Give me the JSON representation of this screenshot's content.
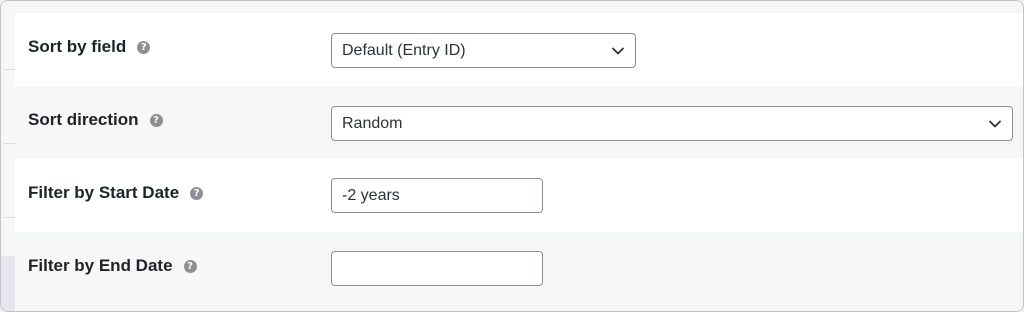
{
  "settings": {
    "sort_field": {
      "label": "Sort by field",
      "value": "Default (Entry ID)"
    },
    "sort_direction": {
      "label": "Sort direction",
      "value": "Random"
    },
    "start_date": {
      "label": "Filter by Start Date",
      "value": "-2 years"
    },
    "end_date": {
      "label": "Filter by End Date",
      "value": ""
    }
  },
  "icons": {
    "help": "question-mark-circle-icon",
    "dropdown": "chevron-down-icon"
  },
  "colors": {
    "row_alt": "#f6f7f7",
    "border": "#8c8f94",
    "help_icon": "#8c8f94"
  }
}
